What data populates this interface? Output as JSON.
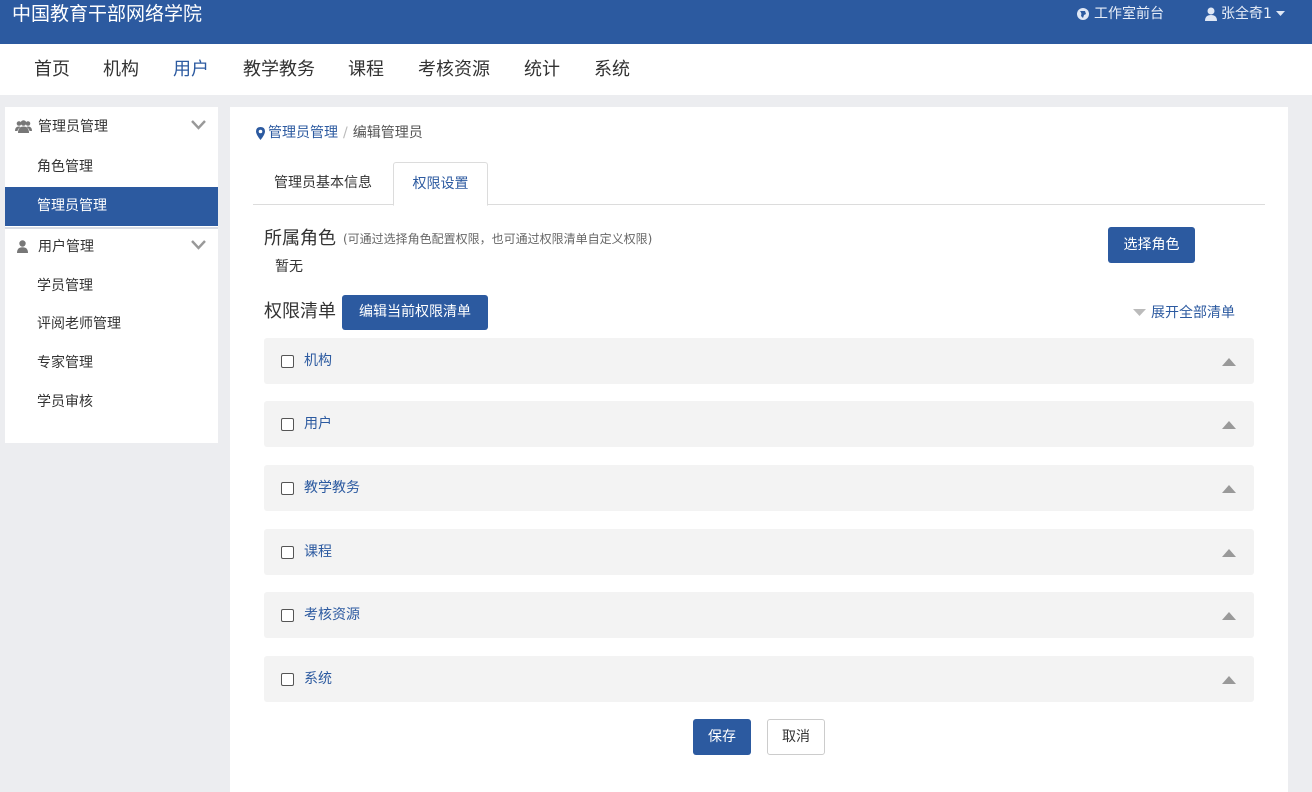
{
  "header": {
    "brand": "中国教育干部网络学院",
    "studio_label": "工作室前台",
    "user_name": "张全奇1"
  },
  "nav": {
    "items": [
      "首页",
      "机构",
      "用户",
      "教学教务",
      "课程",
      "考核资源",
      "统计",
      "系统"
    ],
    "active": "用户"
  },
  "sidebar": {
    "groups": [
      {
        "title": "管理员管理",
        "items": [
          "角色管理",
          "管理员管理"
        ]
      },
      {
        "title": "用户管理",
        "items": [
          "学员管理",
          "评阅老师管理",
          "专家管理",
          "学员审核"
        ]
      }
    ],
    "active_item": "管理员管理"
  },
  "breadcrumb": {
    "parent": "管理员管理",
    "separator": "/",
    "current": "编辑管理员"
  },
  "tabs": {
    "items": [
      "管理员基本信息",
      "权限设置"
    ],
    "active": "权限设置"
  },
  "role": {
    "title": "所属角色",
    "hint": "(可通过选择角色配置权限，也可通过权限清单自定义权限)",
    "value": "暂无",
    "choose_button": "选择角色"
  },
  "permissions": {
    "title": "权限清单",
    "edit_button": "编辑当前权限清单",
    "expand_all": "展开全部清单",
    "items": [
      "机构",
      "用户",
      "教学教务",
      "课程",
      "考核资源",
      "系统"
    ]
  },
  "actions": {
    "save": "保存",
    "cancel": "取消"
  },
  "colors": {
    "brand": "#2c5aa0",
    "page_bg": "#ecedf0",
    "row_bg": "#f3f3f3"
  }
}
